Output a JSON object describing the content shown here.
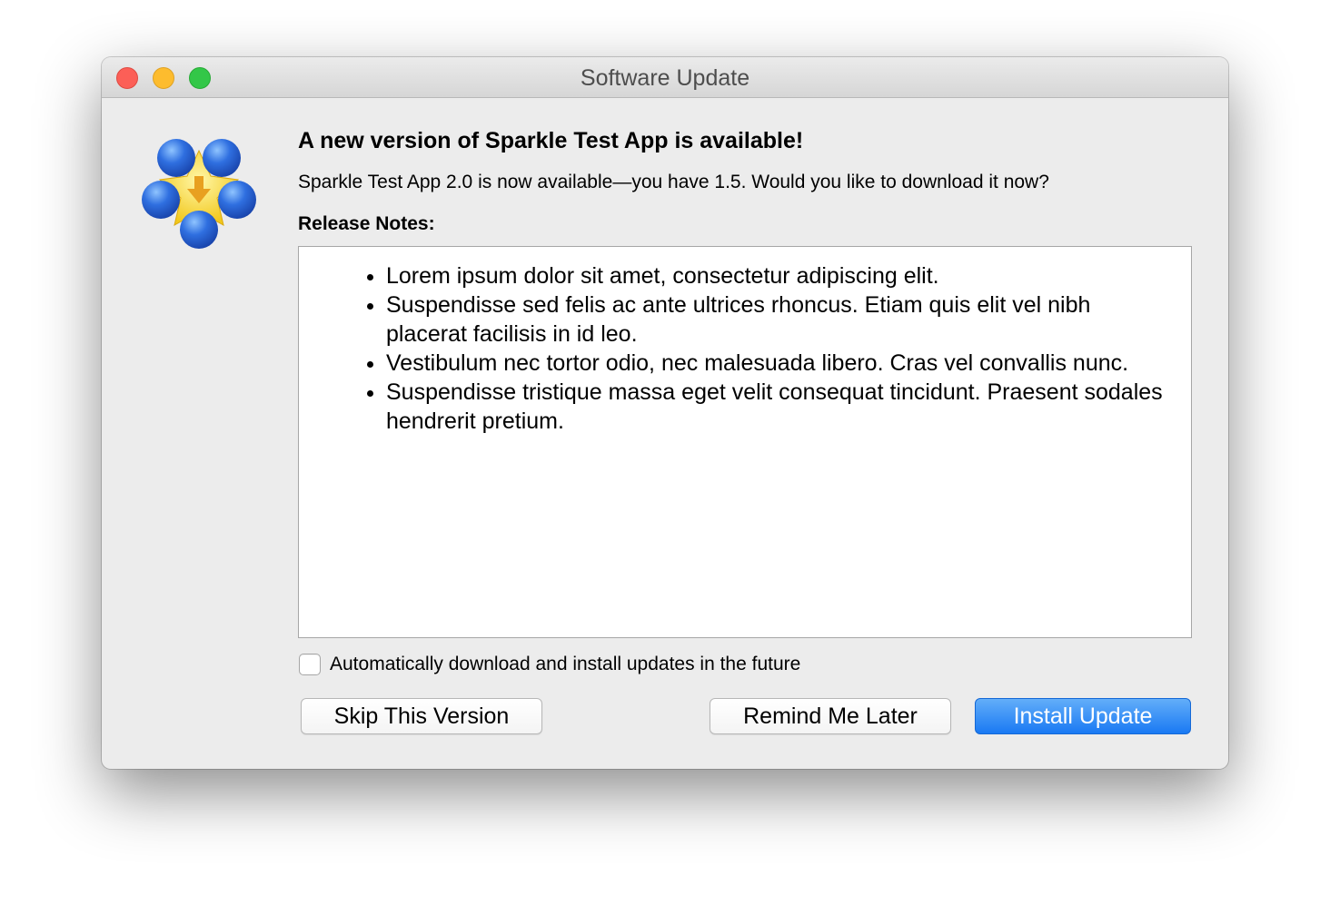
{
  "window": {
    "title": "Software Update"
  },
  "app_icon": {
    "icon": "sparkle-app-icon",
    "colors": {
      "sphere": "#2f6fe0",
      "star": "#f7d733",
      "arrow": "#e8a020"
    }
  },
  "message": {
    "headline": "A new version of Sparkle Test App is available!",
    "detail": "Sparkle Test App 2.0 is now available—you have 1.5. Would you like to download it now?"
  },
  "release_notes": {
    "label": "Release Notes:",
    "items": [
      "Lorem ipsum dolor sit amet, consectetur adipiscing elit.",
      "Suspendisse sed felis ac ante ultrices rhoncus. Etiam quis elit vel nibh placerat facilisis in id leo.",
      "Vestibulum nec tortor odio, nec malesuada libero. Cras vel convallis nunc.",
      "Suspendisse tristique massa eget velit consequat tincidunt. Praesent sodales hendrerit pretium."
    ]
  },
  "auto_update": {
    "label": "Automatically download and install updates in the future",
    "checked": false
  },
  "buttons": {
    "skip": "Skip This Version",
    "remind": "Remind Me Later",
    "install": "Install Update"
  },
  "colors": {
    "accent": "#1979f3",
    "close": "#fc5f57",
    "minimize": "#fdbc2e",
    "maximize": "#33c748"
  }
}
